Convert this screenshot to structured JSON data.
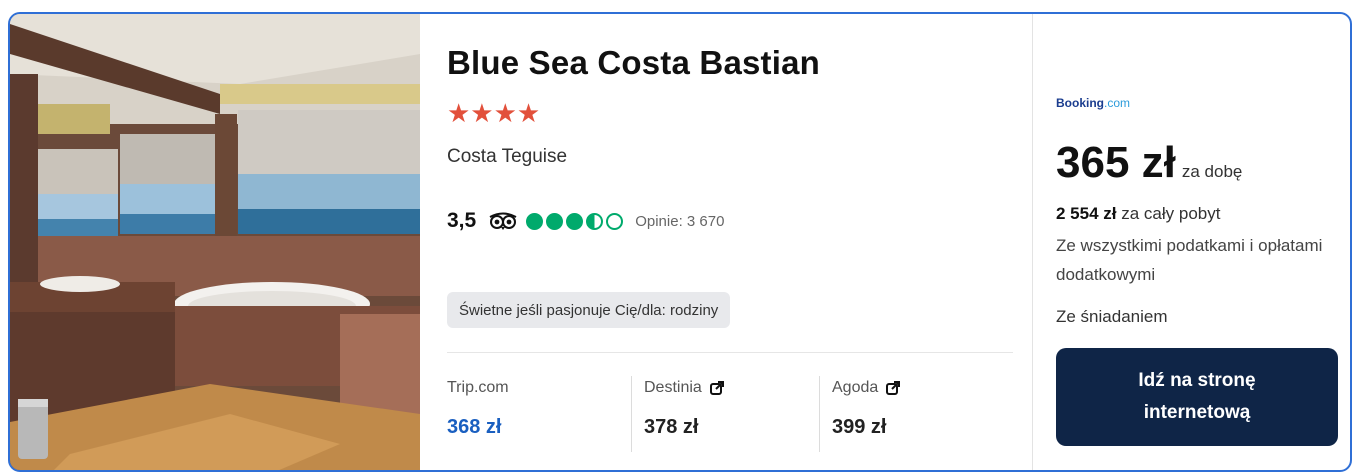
{
  "hotel": {
    "name": "Blue Sea Costa Bastian",
    "stars": "★★★★",
    "location": "Costa Teguise",
    "rating": "3,5",
    "rating_bubbles": 3.5,
    "reviews": "Opinie: 3 670",
    "tag": "Świetne jeśli pasjonuje Cię/dla: rodziny"
  },
  "providers": [
    {
      "name": "Trip.com",
      "price": "368 zł",
      "external": false
    },
    {
      "name": "Destinia",
      "price": "378 zł",
      "external": true
    },
    {
      "name": "Agoda",
      "price": "399 zł",
      "external": true
    }
  ],
  "offer": {
    "provider_logo": "Booking",
    "provider_logo_suffix": ".com",
    "price": "365 zł",
    "price_unit": "za dobę",
    "total_amount": "2 554 zł",
    "total_label": "za cały pobyt",
    "taxes_note": "Ze wszystkimi podatkami i opłatami dodatkowymi",
    "meal": "Ze śniadaniem",
    "cta_label": "Idź na stronę internetową"
  },
  "colors": {
    "accent_border": "#2f6fd6",
    "stars": "#e2503b",
    "rating_green": "#00aa6c",
    "cta_bg": "#0f2547",
    "link_price": "#1a5fc0"
  }
}
